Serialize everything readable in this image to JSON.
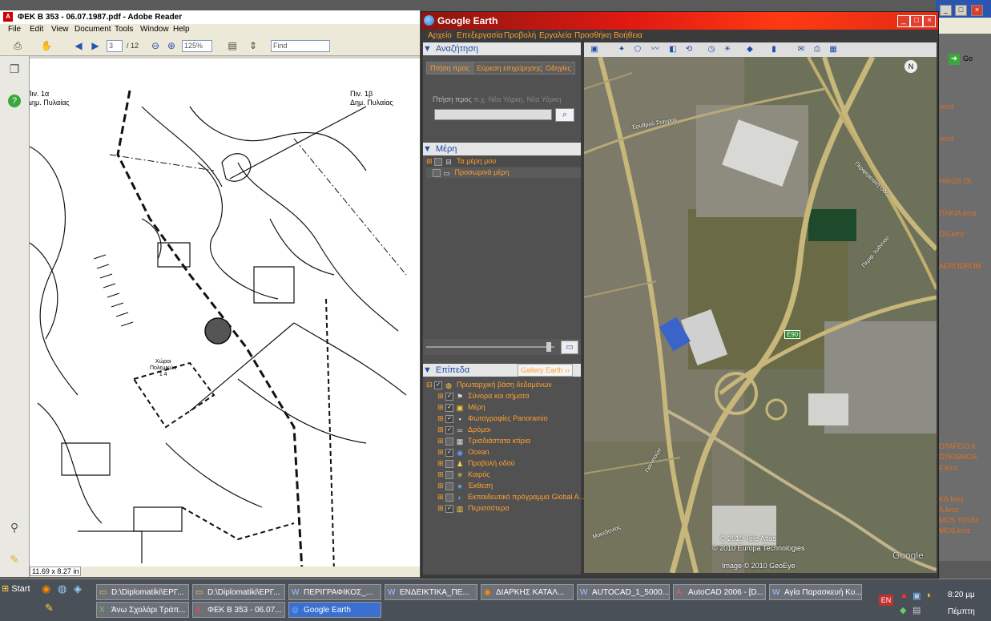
{
  "bg_explorer": {
    "go_label": "Go",
    "files": [
      "HIKOS OI",
      "ITAKIA.kmz",
      "OS.kmz",
      "AERODROM",
      "OTAFEIO.k",
      "OTKISMOS",
      "F.kmz",
      "KA.kmz",
      "A.kmz",
      "MOS TOUM",
      "MOS.kmz"
    ]
  },
  "reader": {
    "title": "ΦΕΚ Β 353 - 06.07.1987.pdf - Adobe Reader",
    "menu": [
      "File",
      "Edit",
      "View",
      "Document",
      "Tools",
      "Window",
      "Help"
    ],
    "page_current": "3",
    "page_total": "/ 12",
    "zoom": "125%",
    "find_placeholder": "Find",
    "page_size": "11.69 x 8.27 in",
    "map_labels": {
      "left_top": "Πιν. 1α\nΔημ. Πυλαίας",
      "right_top": "Πιν. 1β\nΔημ. Πυλαίας",
      "choros": "Χώροι\nΠολεμικών\n1 4"
    }
  },
  "earth": {
    "title": "Google Earth",
    "menu": [
      "Αρχείο",
      "Επεξεργασία",
      "Προβολή",
      "Εργαλεία",
      "Προσθήκη",
      "Βοήθεια"
    ],
    "search": {
      "header": "Αναζήτηση",
      "tabs": [
        "Πτήση προς",
        "Εύρεση επιχείρησης",
        "Οδηγίες"
      ],
      "label": "Πτήση προς",
      "placeholder": "π.χ. Νέα Υόρκη, Νέα Υόρκη"
    },
    "places": {
      "header": "Μέρη",
      "items": [
        "Τα μέρη μου",
        "Προσωρινά μέρη"
      ]
    },
    "layers": {
      "header": "Επίπεδα",
      "gallery": "Gallery Earth",
      "items": [
        {
          "label": "Πρωταρχική βάση δεδομένων",
          "checked": true,
          "icon": "globe-icon"
        },
        {
          "label": "Σύνορα και σήματα",
          "checked": true,
          "icon": "flag-icon"
        },
        {
          "label": "Μέρη",
          "checked": true,
          "icon": "places-icon"
        },
        {
          "label": "Φωτογραφίες Panoramio",
          "checked": true,
          "icon": "photo-icon"
        },
        {
          "label": "Δρόμοι",
          "checked": true,
          "icon": "road-icon"
        },
        {
          "label": "Τρισδιάστατα κτίρια",
          "checked": false,
          "icon": "building-icon"
        },
        {
          "label": "Ocean",
          "checked": true,
          "icon": "ocean-icon"
        },
        {
          "label": "Προβολή οδού",
          "checked": false,
          "icon": "pegman-icon"
        },
        {
          "label": "Καιρός",
          "checked": false,
          "icon": "weather-icon"
        },
        {
          "label": "Έκθεση",
          "checked": false,
          "icon": "gallery-icon"
        },
        {
          "label": "Εκπαιδευτικό πρόγραμμα Global A...",
          "checked": false,
          "icon": "education-icon"
        },
        {
          "label": "Περισσότερα",
          "checked": true,
          "icon": "more-icon"
        }
      ]
    },
    "map": {
      "road_shield": "E90",
      "credits": [
        "© 2010 Tele Atlas",
        "© 2010 Europa Technologies",
        "Image © 2010 GeoEye"
      ],
      "brand": "Google",
      "street_labels": [
        "Ερυθρού Σταυρού",
        "Περιφερειακή Οδός",
        "Περιφ. Ιωάννου",
        "Μακεδονίας",
        "Γιαννιτσών"
      ]
    }
  },
  "taskbar": {
    "start": "Start",
    "row1": [
      {
        "label": "D:\\Diplomatiki\\ΕΡΓ...",
        "icon": "folder-icon"
      },
      {
        "label": "D:\\Diplomatiki\\ΕΡΓ...",
        "icon": "folder-icon"
      },
      {
        "label": "ΠΕΡΙΓΡΑΦΙΚΟΣ_...",
        "icon": "word-icon"
      },
      {
        "label": "ΕΝΔΕΙΚΤΙΚΑ_ΠΕ...",
        "icon": "word-icon"
      },
      {
        "label": "ΔΙΑΡΚΗΣ ΚΑΤΑΛ...",
        "icon": "firefox-icon"
      },
      {
        "label": "AUTOCAD_1_5000...",
        "icon": "word-icon"
      },
      {
        "label": "AutoCAD 2006 - [D...",
        "icon": "autocad-icon"
      },
      {
        "label": "Αγία Παρασκευή Κυ...",
        "icon": "word-icon"
      }
    ],
    "row2": [
      {
        "label": "Άνω Σχολάρι Τράπ...",
        "icon": "excel-icon"
      },
      {
        "label": "ΦΕΚ Β 353 - 06.07...",
        "icon": "pdf-icon"
      },
      {
        "label": "Google Earth",
        "icon": "earth-icon"
      }
    ],
    "lang": "EN",
    "time": "8:20 μμ",
    "day": "Πέμπτη"
  }
}
